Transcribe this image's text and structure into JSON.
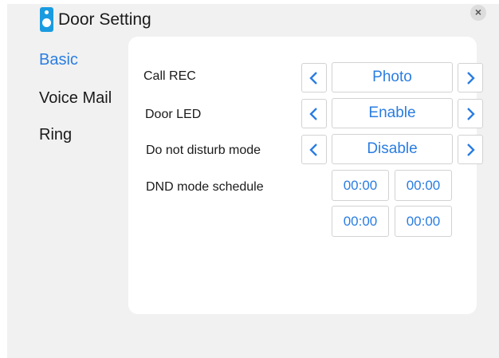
{
  "app": {
    "title": "Door Setting",
    "close_label": "×"
  },
  "sidebar": {
    "items": [
      {
        "label": "Basic",
        "active": true
      },
      {
        "label": "Voice Mail",
        "active": false
      },
      {
        "label": "Ring",
        "active": false
      }
    ]
  },
  "settings": {
    "call_rec": {
      "label": "Call REC",
      "value": "Photo"
    },
    "door_led": {
      "label": "Door LED",
      "value": "Enable"
    },
    "dnd_mode": {
      "label": "Do not disturb mode",
      "value": "Disable"
    },
    "dnd_schedule": {
      "label": "DND mode schedule",
      "times": [
        [
          "00:00",
          "00:00"
        ],
        [
          "00:00",
          "00:00"
        ]
      ]
    }
  },
  "icons": {
    "title": "door-icon",
    "close": "close-icon",
    "prev": "chevron-left-icon",
    "next": "chevron-right-icon"
  },
  "colors": {
    "accent": "#2a7de1",
    "icon": "#1a9be0",
    "background": "#f1f1f1",
    "panel": "#ffffff"
  }
}
